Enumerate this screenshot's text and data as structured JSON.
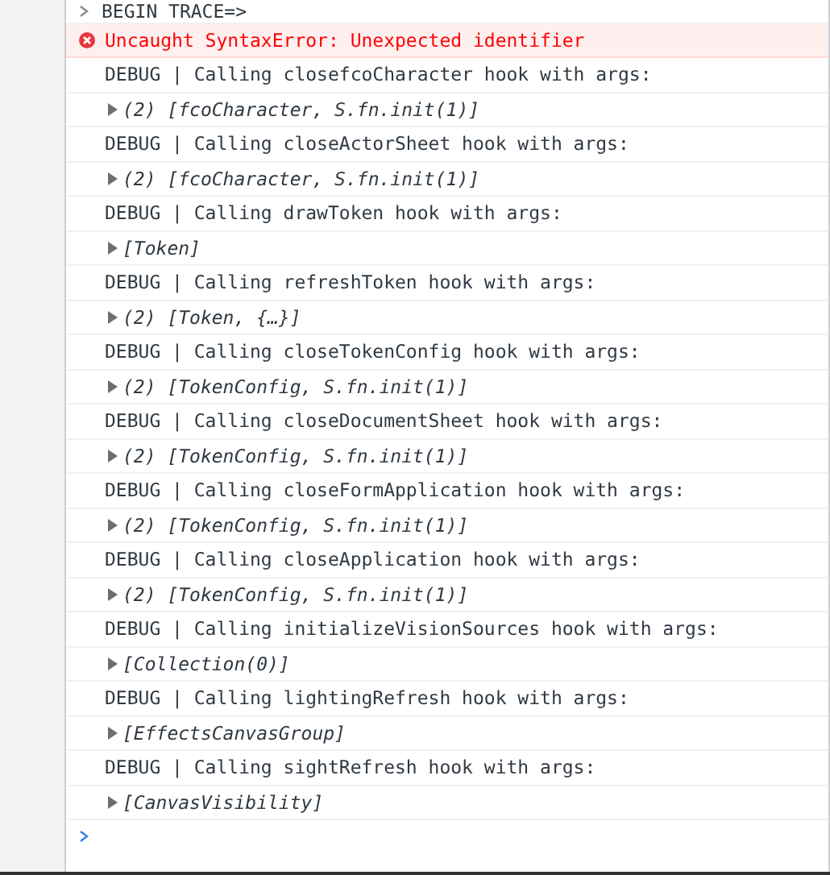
{
  "console": {
    "entries": [
      {
        "kind": "command",
        "text": "BEGIN TRACE=>"
      },
      {
        "kind": "error",
        "text": "Uncaught SyntaxError: Unexpected identifier"
      },
      {
        "kind": "log",
        "text": "DEBUG | Calling closefcoCharacter hook with args:"
      },
      {
        "kind": "object",
        "text": "(2) [fcoCharacter, S.fn.init(1)]"
      },
      {
        "kind": "log",
        "text": "DEBUG | Calling closeActorSheet hook with args:"
      },
      {
        "kind": "object",
        "text": "(2) [fcoCharacter, S.fn.init(1)]"
      },
      {
        "kind": "log",
        "text": "DEBUG | Calling drawToken hook with args:"
      },
      {
        "kind": "object",
        "text": "[Token]"
      },
      {
        "kind": "log",
        "text": "DEBUG | Calling refreshToken hook with args:"
      },
      {
        "kind": "object",
        "text": "(2) [Token, {…}]"
      },
      {
        "kind": "log",
        "text": "DEBUG | Calling closeTokenConfig hook with args:"
      },
      {
        "kind": "object",
        "text": "(2) [TokenConfig, S.fn.init(1)]"
      },
      {
        "kind": "log",
        "text": "DEBUG | Calling closeDocumentSheet hook with args:"
      },
      {
        "kind": "object",
        "text": "(2) [TokenConfig, S.fn.init(1)]"
      },
      {
        "kind": "log",
        "text": "DEBUG | Calling closeFormApplication hook with args:"
      },
      {
        "kind": "object",
        "text": "(2) [TokenConfig, S.fn.init(1)]"
      },
      {
        "kind": "log",
        "text": "DEBUG | Calling closeApplication hook with args:"
      },
      {
        "kind": "object",
        "text": "(2) [TokenConfig, S.fn.init(1)]"
      },
      {
        "kind": "log",
        "text": "DEBUG | Calling initializeVisionSources hook with args:"
      },
      {
        "kind": "object",
        "text": "[Collection(0)]"
      },
      {
        "kind": "log",
        "text": "DEBUG | Calling lightingRefresh hook with args:"
      },
      {
        "kind": "object",
        "text": "[EffectsCanvasGroup]"
      },
      {
        "kind": "log",
        "text": "DEBUG | Calling sightRefresh hook with args:"
      },
      {
        "kind": "object",
        "text": "[CanvasVisibility]"
      },
      {
        "kind": "prompt"
      }
    ]
  }
}
